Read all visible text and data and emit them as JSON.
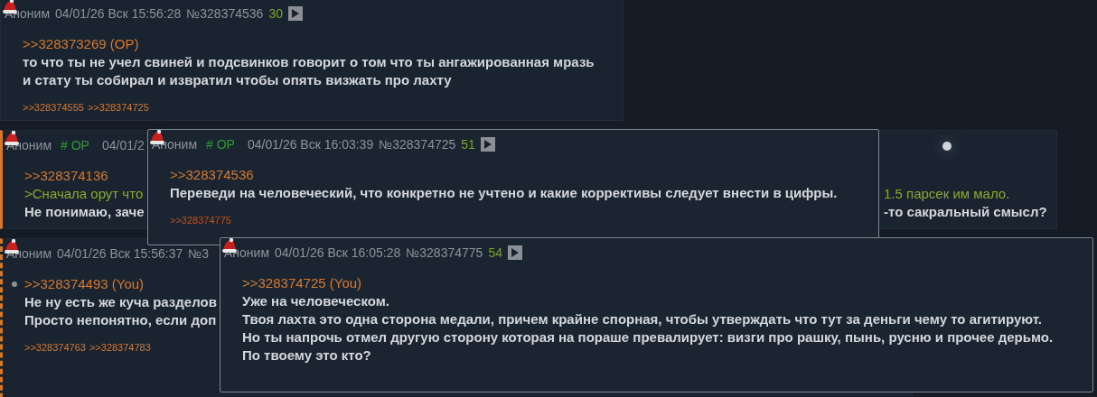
{
  "posts": [
    {
      "author": "Аноним",
      "datetime": "04/01/26 Вск 15:56:28",
      "number": "№328374536",
      "count": "30",
      "play": true,
      "kind": "plain",
      "bullet": false,
      "quote": ">>328373269 (OP)",
      "lines": [
        {
          "kind": "text",
          "left": "то что ты не учел свиней и подсвинков говорит о том что ты ангажированная мразь"
        },
        {
          "kind": "text",
          "left": "и стату ты собирал и извратил чтобы опять визжать про лахту"
        }
      ],
      "replies": [
        {
          "text": ">>328374555",
          "visited": false
        },
        {
          "text": ">>328374725",
          "visited": false
        }
      ]
    },
    {
      "author": "Аноним",
      "tripcode": "# OP",
      "datetime": "04/01/2",
      "kind": "highlighted",
      "bullet": false,
      "quote": ">>328374136",
      "lines": [
        {
          "kind": "greentext",
          "left": ">Сначала орут что",
          "right": "1.5 парсек им мало."
        },
        {
          "kind": "text",
          "left": "Не понимаю, заче",
          "right": "-то сакральный смысл?"
        }
      ]
    },
    {
      "author": "Аноним",
      "datetime": "04/01/26 Вск 15:56:37",
      "number": "№3",
      "kind": "own",
      "bullet": true,
      "quote": ">>328374493 (You)",
      "lines": [
        {
          "kind": "text",
          "left": "Не ну есть же куча разделов"
        },
        {
          "kind": "text",
          "left": "Просто непонятно, если доп"
        }
      ],
      "replies": [
        {
          "text": ">>328374763",
          "visited": false
        },
        {
          "text": ">>328374783",
          "visited": false
        }
      ]
    }
  ],
  "previews": [
    {
      "author": "Аноним",
      "tripcode": "# OP",
      "datetime": "04/01/26 Вск 16:03:39",
      "number": "№328374725",
      "count": "51",
      "play": true,
      "bullet": false,
      "quote": ">>328374536",
      "lines": [
        {
          "kind": "text",
          "left": "Переведи на человеческий, что конкретно не учтено и какие коррективы следует внести в цифры."
        }
      ],
      "replies": [
        {
          "text": ">>328374775",
          "visited": true
        }
      ]
    },
    {
      "author": "Аноним",
      "datetime": "04/01/26 Вск 16:05:28",
      "number": "№328374775",
      "count": "54",
      "play": true,
      "bullet": false,
      "quote": ">>328374725 (You)",
      "lines": [
        {
          "kind": "text",
          "left": "Уже на человеческом."
        },
        {
          "kind": "text",
          "left": "Твоя лахта это одна сторона медали, причем крайне спорная, чтобы утверждать что тут за деньги чему то агитируют."
        },
        {
          "kind": "text",
          "left": "Но ты напрочь отмел другую сторону которая на пораше превалирует: визги про рашку, пынь, русню и прочее дерьмо."
        },
        {
          "kind": "text",
          "left": "По твоему это кто?"
        }
      ]
    }
  ]
}
